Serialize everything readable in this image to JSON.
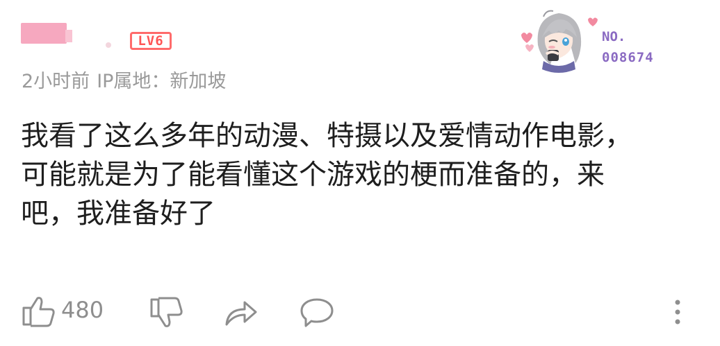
{
  "comment": {
    "level_badge": "LV6",
    "meta": {
      "time": "2小时前",
      "ip_location": "IP属地：新加坡"
    },
    "text": "我看了这么多年的动漫、特摄以及爱情动作电影，可能就是为了能看懂这个游戏的梗而准备的，来吧，我准备好了",
    "fan_badge": {
      "label": "NO.",
      "number": "008674"
    }
  },
  "actions": {
    "like_count": "480",
    "icons": [
      "thumbs-up-icon",
      "thumbs-down-icon",
      "share-icon",
      "comment-icon",
      "more-icon"
    ]
  },
  "colors": {
    "level_badge": "#ff5555",
    "meta_text": "#9a9a9a",
    "body_text": "#1e1e1e",
    "icon_gray": "#8e8e8e",
    "badge_purple": "#8a6ac2",
    "username_blur": "#f6a8bf"
  }
}
